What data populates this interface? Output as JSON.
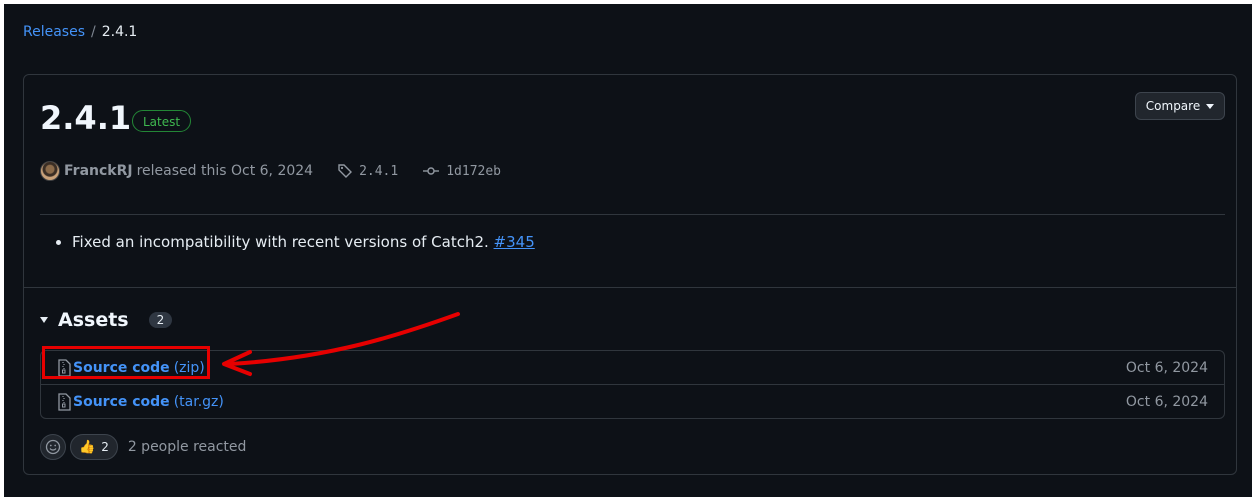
{
  "breadcrumb": {
    "parent": "Releases",
    "separator": "/",
    "current": "2.4.1"
  },
  "release": {
    "version": "2.4.1",
    "badge": "Latest",
    "compare_label": "Compare",
    "author": "FranckRJ",
    "released_text": "released this Oct 6, 2024",
    "tag": "2.4.1",
    "commit": "1d172eb",
    "notes": [
      {
        "text": "Fixed an incompatibility with recent versions of Catch2. ",
        "link": "#345"
      }
    ]
  },
  "assets": {
    "title": "Assets",
    "count": "2",
    "items": [
      {
        "name": "Source code",
        "ext": "(zip)",
        "date": "Oct 6, 2024"
      },
      {
        "name": "Source code",
        "ext": "(tar.gz)",
        "date": "Oct 6, 2024"
      }
    ]
  },
  "reactions": {
    "thumbs_count": "2",
    "summary": "2 people reacted"
  },
  "colors": {
    "accent": "#4493f8",
    "annotation": "#e60000",
    "badge_green": "#3fb950",
    "background": "#0d1117"
  }
}
